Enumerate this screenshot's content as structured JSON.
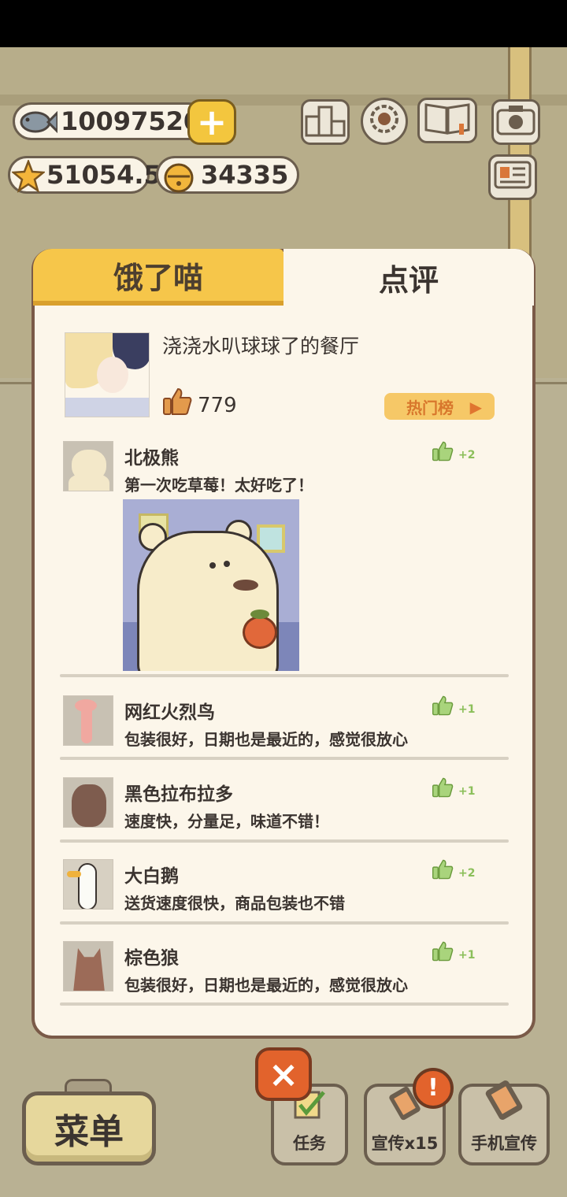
{
  "currency": {
    "fish": "10097520",
    "stars": "51054.5",
    "bells": "34335",
    "plus_label": "+"
  },
  "tabs": {
    "hungry_label": "饿了喵",
    "review_label": "点评"
  },
  "restaurant": {
    "name": "浇浇水叭球球了的餐厅",
    "likes": "779",
    "hot_button_label": "热门榜",
    "hot_button_arrow": "▶"
  },
  "reviews": [
    {
      "name": "北极熊",
      "text": "第一次吃草莓！太好吃了！",
      "likes": "+2"
    },
    {
      "name": "网红火烈鸟",
      "text": "包装很好，日期也是最近的，感觉很放心",
      "likes": "+1"
    },
    {
      "name": "黑色拉布拉多",
      "text": "速度快，分量足，味道不错！",
      "likes": "+1"
    },
    {
      "name": "大白鹅",
      "text": "送货速度很快，商品包装也不错",
      "likes": "+2"
    },
    {
      "name": "棕色狼",
      "text": "包装很好，日期也是最近的，感觉很放心",
      "likes": "+1"
    }
  ],
  "bottom": {
    "menu_label": "菜单",
    "task_label": "任务",
    "promo_label": "宣传x15",
    "phone_promo_label": "手机宣传",
    "close_label": "×",
    "alert_label": "!"
  },
  "icons": {
    "fish": "fish-icon",
    "star": "star-icon",
    "bell": "bell-icon",
    "thumb": "thumbs-up-icon",
    "ranking": "ranking-icon",
    "settings": "gear-icon",
    "book": "book-icon",
    "camera": "camera-icon",
    "card": "id-card-icon"
  },
  "colors": {
    "accent_yellow": "#f6c64a",
    "panel_bg": "#fcf6ea",
    "like_green": "#8bbf5a",
    "close_orange": "#e2632c"
  }
}
